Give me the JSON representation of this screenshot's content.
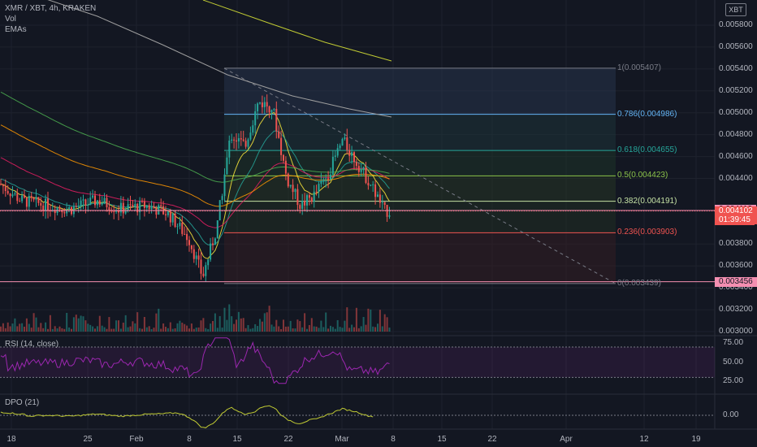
{
  "header": {
    "symbol_line": "XMR / XBT, 4h, KRAKEN",
    "vol_label": "Vol",
    "emas_label": "EMAs",
    "currency": "XBT"
  },
  "price_axis": {
    "ticks": [
      "0.005800",
      "0.005600",
      "0.005400",
      "0.005200",
      "0.005000",
      "0.004800",
      "0.004600",
      "0.004400",
      "0.003800",
      "0.003600",
      "0.003400",
      "0.003200",
      "0.003000"
    ],
    "tick_values": [
      0.0058,
      0.0056,
      0.0054,
      0.0052,
      0.005,
      0.0048,
      0.0046,
      0.0044,
      0.0038,
      0.0036,
      0.0034,
      0.0032,
      0.003
    ],
    "badge_upper": "0.004112",
    "badge_current": "0.004102",
    "badge_timer": "01:39:45",
    "badge_lower": "0.003456",
    "upper_value": 0.004112,
    "current_value": 0.004102,
    "lower_value": 0.003456
  },
  "time_axis": {
    "labels": [
      "18",
      "25",
      "Feb",
      "8",
      "15",
      "22",
      "Mar",
      "8",
      "15",
      "22",
      "Apr",
      "12",
      "19"
    ]
  },
  "fib_levels": [
    {
      "label": "1(0.005407)",
      "value": 0.005407,
      "color": "#787b86"
    },
    {
      "label": "0.786(0.004986)",
      "value": 0.004986,
      "color": "#64b5f6"
    },
    {
      "label": "0.618(0.004655)",
      "value": 0.004655,
      "color": "#26a69a"
    },
    {
      "label": "0.5(0.004423)",
      "value": 0.004423,
      "color": "#8bc34a"
    },
    {
      "label": "0.382(0.004191)",
      "value": 0.004191,
      "color": "#c5e1a5"
    },
    {
      "label": "0.236(0.003903)",
      "value": 0.003903,
      "color": "#ef5350"
    },
    {
      "label": "0(0.003439)",
      "value": 0.003439,
      "color": "#787b86"
    }
  ],
  "rsi": {
    "title": "RSI (14, close)",
    "ticks": [
      "75.00",
      "50.00",
      "25.00"
    ],
    "tick_values": [
      75,
      50,
      25
    ]
  },
  "dpo": {
    "title": "DPO (21)",
    "ticks": [
      "0.00"
    ]
  },
  "colors": {
    "background": "#131722",
    "up": "#26a69a",
    "down": "#ef5350",
    "rsi_line": "#9c27b0",
    "dpo_line": "#c0ca33",
    "badge_red": "#f05350",
    "badge_pink": "#f48fb1"
  },
  "chart_data": {
    "type": "candlestick",
    "title": "XMR / XBT, 4h, KRAKEN",
    "ylim": [
      0.0029,
      0.0059
    ],
    "close_points": [
      [
        "Jan 11",
        0.00435
      ],
      [
        "Jan 14",
        0.0042
      ],
      [
        "Jan 18",
        0.00415
      ],
      [
        "Jan 21",
        0.00412
      ],
      [
        "Jan 25",
        0.0042
      ],
      [
        "Jan 28",
        0.00412
      ],
      [
        "Feb 1",
        0.00415
      ],
      [
        "Feb 4",
        0.00408
      ],
      [
        "Feb 7",
        0.00385
      ],
      [
        "Feb 9",
        0.0035
      ],
      [
        "Feb 11",
        0.00395
      ],
      [
        "Feb 13",
        0.0048
      ],
      [
        "Feb 15",
        0.0047
      ],
      [
        "Feb 17",
        0.0051
      ],
      [
        "Feb 19",
        0.00505
      ],
      [
        "Feb 21",
        0.0044
      ],
      [
        "Feb 23",
        0.00415
      ],
      [
        "Feb 25",
        0.00425
      ],
      [
        "Feb 27",
        0.00445
      ],
      [
        "Mar 1",
        0.00475
      ],
      [
        "Mar 3",
        0.00455
      ],
      [
        "Mar 5",
        0.00435
      ],
      [
        "Mar 7",
        0.0041
      ]
    ]
  }
}
